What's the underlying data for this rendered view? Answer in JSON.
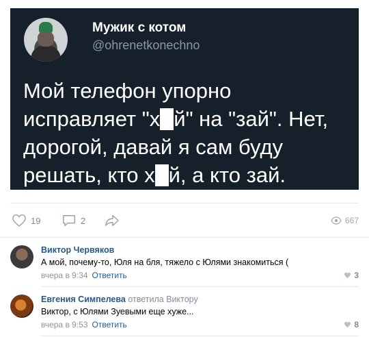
{
  "tweet": {
    "name": "Мужик с котом",
    "handle": "@ohrenetkonechno",
    "text": {
      "line1": "Мой телефон упорно",
      "line2_a": "исправляет \"х",
      "line2_b": "й\" на \"зай\". Нет,",
      "line3": "дорогой, давай я сам буду",
      "line4_a": "решать, кто х",
      "line4_b": "й, а кто зай."
    },
    "background_color": "#16202b"
  },
  "post_actions": {
    "likes": "19",
    "comments": "2",
    "views": "667",
    "icons": [
      "heart-icon",
      "comment-icon",
      "share-icon",
      "eye-icon"
    ]
  },
  "comments": [
    {
      "author": "Виктор Червяков",
      "reply_to": "",
      "text": "А мой, почему-то, Юля на бля, тяжело с Юлями знакомиться (",
      "time": "вчера в 9:34",
      "reply_label": "Ответить",
      "likes": "3"
    },
    {
      "author": "Евгения Симпелева",
      "reply_to": "ответила Виктору",
      "text": "Виктор, с Юлями Зуевыми еще хуже...",
      "time": "вчера в 9:53",
      "reply_label": "Ответить",
      "likes": "8"
    }
  ],
  "colors": {
    "link": "#2a5885",
    "meta": "#828a99",
    "divider": "#e7e8ec"
  }
}
